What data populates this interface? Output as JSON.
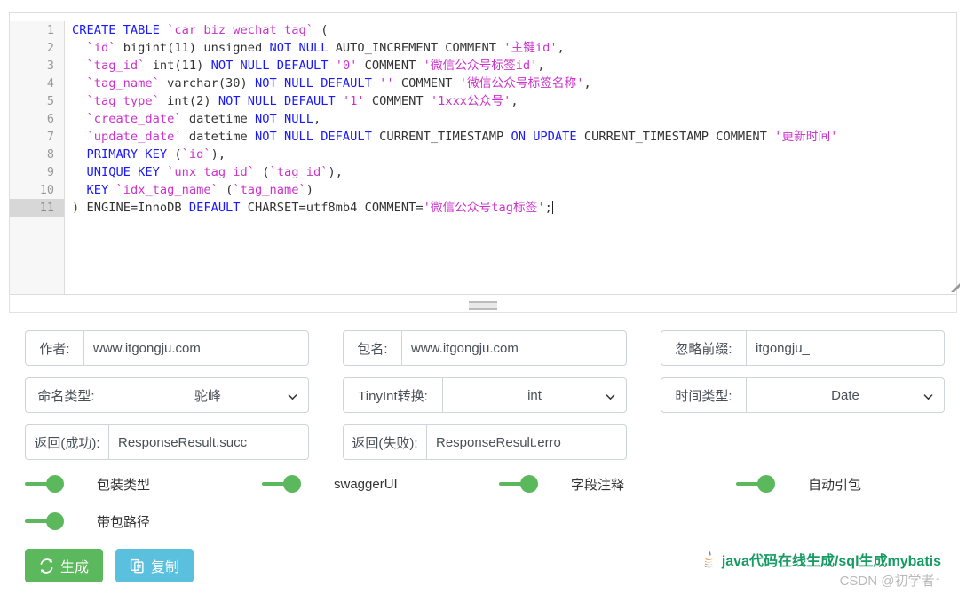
{
  "editor": {
    "name": "sql-code-editor",
    "active_line": 11,
    "caret_line": 11,
    "line_numbers": [
      1,
      2,
      3,
      4,
      5,
      6,
      7,
      8,
      9,
      10,
      11
    ],
    "lines": [
      [
        {
          "t": "CREATE TABLE ",
          "c": "kw"
        },
        {
          "t": "`car_biz_wechat_tag`",
          "c": "bt"
        },
        {
          "t": " (",
          "c": "plain"
        }
      ],
      [
        {
          "t": "  ",
          "c": "plain"
        },
        {
          "t": "`id`",
          "c": "bt"
        },
        {
          "t": " bigint(11) unsigned ",
          "c": "plain"
        },
        {
          "t": "NOT NULL",
          "c": "kw"
        },
        {
          "t": " AUTO_INCREMENT COMMENT ",
          "c": "plain"
        },
        {
          "t": "'主键id'",
          "c": "str"
        },
        {
          "t": ",",
          "c": "plain"
        }
      ],
      [
        {
          "t": "  ",
          "c": "plain"
        },
        {
          "t": "`tag_id`",
          "c": "bt"
        },
        {
          "t": " int(11) ",
          "c": "plain"
        },
        {
          "t": "NOT NULL DEFAULT",
          "c": "kw"
        },
        {
          "t": " ",
          "c": "plain"
        },
        {
          "t": "'0'",
          "c": "str"
        },
        {
          "t": " COMMENT ",
          "c": "plain"
        },
        {
          "t": "'微信公众号标签id'",
          "c": "str"
        },
        {
          "t": ",",
          "c": "plain"
        }
      ],
      [
        {
          "t": "  ",
          "c": "plain"
        },
        {
          "t": "`tag_name`",
          "c": "bt"
        },
        {
          "t": " varchar(30) ",
          "c": "plain"
        },
        {
          "t": "NOT NULL DEFAULT",
          "c": "kw"
        },
        {
          "t": " ",
          "c": "plain"
        },
        {
          "t": "''",
          "c": "str"
        },
        {
          "t": " COMMENT ",
          "c": "plain"
        },
        {
          "t": "'微信公众号标签名称'",
          "c": "str"
        },
        {
          "t": ",",
          "c": "plain"
        }
      ],
      [
        {
          "t": "  ",
          "c": "plain"
        },
        {
          "t": "`tag_type`",
          "c": "bt"
        },
        {
          "t": " int(2) ",
          "c": "plain"
        },
        {
          "t": "NOT NULL DEFAULT",
          "c": "kw"
        },
        {
          "t": " ",
          "c": "plain"
        },
        {
          "t": "'1'",
          "c": "str"
        },
        {
          "t": " COMMENT ",
          "c": "plain"
        },
        {
          "t": "'1xxx公众号'",
          "c": "str"
        },
        {
          "t": ",",
          "c": "plain"
        }
      ],
      [
        {
          "t": "  ",
          "c": "plain"
        },
        {
          "t": "`create_date`",
          "c": "bt"
        },
        {
          "t": " datetime ",
          "c": "plain"
        },
        {
          "t": "NOT NULL",
          "c": "kw"
        },
        {
          "t": ",",
          "c": "plain"
        }
      ],
      [
        {
          "t": "  ",
          "c": "plain"
        },
        {
          "t": "`update_date`",
          "c": "bt"
        },
        {
          "t": " datetime ",
          "c": "plain"
        },
        {
          "t": "NOT NULL DEFAULT",
          "c": "kw"
        },
        {
          "t": " CURRENT_TIMESTAMP ",
          "c": "plain"
        },
        {
          "t": "ON UPDATE",
          "c": "kw"
        },
        {
          "t": " CURRENT_TIMESTAMP COMMENT ",
          "c": "plain"
        },
        {
          "t": "'更新时间'",
          "c": "str"
        }
      ],
      [
        {
          "t": "  ",
          "c": "plain"
        },
        {
          "t": "PRIMARY KEY",
          "c": "kw"
        },
        {
          "t": " (",
          "c": "plain"
        },
        {
          "t": "`id`",
          "c": "bt"
        },
        {
          "t": "),",
          "c": "plain"
        }
      ],
      [
        {
          "t": "  ",
          "c": "plain"
        },
        {
          "t": "UNIQUE KEY",
          "c": "kw"
        },
        {
          "t": " ",
          "c": "plain"
        },
        {
          "t": "`unx_tag_id`",
          "c": "bt"
        },
        {
          "t": " (",
          "c": "plain"
        },
        {
          "t": "`tag_id`",
          "c": "bt"
        },
        {
          "t": "),",
          "c": "plain"
        }
      ],
      [
        {
          "t": "  ",
          "c": "plain"
        },
        {
          "t": "KEY",
          "c": "kw"
        },
        {
          "t": " ",
          "c": "plain"
        },
        {
          "t": "`idx_tag_name`",
          "c": "bt"
        },
        {
          "t": " (",
          "c": "plain"
        },
        {
          "t": "`tag_name`",
          "c": "bt"
        },
        {
          "t": ")",
          "c": "plain"
        }
      ],
      [
        {
          "t": ")",
          "c": "punct"
        },
        {
          "t": " ENGINE=InnoDB ",
          "c": "plain"
        },
        {
          "t": "DEFAULT",
          "c": "kw"
        },
        {
          "t": " CHARSET=utf8mb4 COMMENT=",
          "c": "plain"
        },
        {
          "t": "'微信公众号tag标签'",
          "c": "str"
        },
        {
          "t": ";",
          "c": "plain"
        }
      ]
    ]
  },
  "form": {
    "rows": [
      [
        {
          "label": "作者:",
          "type": "text",
          "value": "www.itgongju.com",
          "name": "author"
        },
        {
          "label": "包名:",
          "type": "text",
          "value": "www.itgongju.com",
          "name": "package-name"
        },
        {
          "label": "忽略前缀:",
          "type": "text",
          "value": "itgongju_",
          "name": "ignore-prefix"
        }
      ],
      [
        {
          "label": "命名类型:",
          "type": "select",
          "value": "驼峰",
          "name": "naming-type"
        },
        {
          "label": "TinyInt转换:",
          "type": "select",
          "value": "int",
          "name": "tinyint-convert"
        },
        {
          "label": "时间类型:",
          "type": "select",
          "value": "Date",
          "name": "date-type"
        }
      ],
      [
        {
          "label": "返回(成功):",
          "type": "text",
          "value": "ResponseResult.succ",
          "name": "return-success"
        },
        {
          "label": "返回(失败):",
          "type": "text",
          "value": "ResponseResult.erro",
          "name": "return-failure"
        }
      ]
    ]
  },
  "switches": {
    "rows": [
      [
        {
          "label": "包装类型",
          "on": true,
          "name": "wrapper-type"
        },
        {
          "label": "swaggerUI",
          "on": true,
          "name": "swagger-ui"
        },
        {
          "label": "字段注释",
          "on": true,
          "name": "field-comment"
        },
        {
          "label": "自动引包",
          "on": true,
          "name": "auto-import"
        }
      ],
      [
        {
          "label": "带包路径",
          "on": true,
          "name": "with-package-path"
        }
      ]
    ],
    "on_color": "#5cb85c"
  },
  "buttons": {
    "generate": {
      "label": "生成",
      "icon": "refresh-icon",
      "color": "#5cb85c"
    },
    "copy": {
      "label": "复制",
      "icon": "copy-icon",
      "color": "#5bc0de"
    }
  },
  "footer": {
    "brand": "java代码在线生成/sql生成mybatis",
    "brand_color": "#169b62",
    "watermark": "CSDN @初学者↑"
  }
}
